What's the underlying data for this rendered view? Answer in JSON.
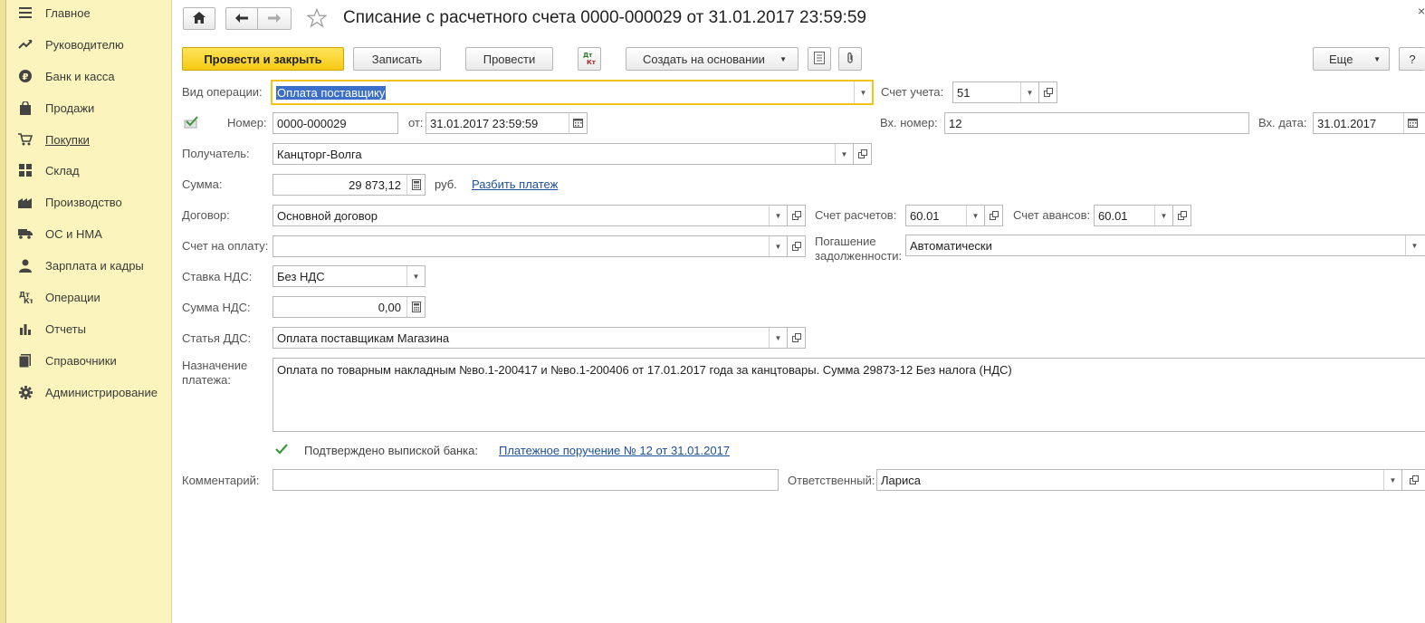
{
  "sidebar": {
    "items": [
      {
        "label": "Главное",
        "icon": "menu-icon"
      },
      {
        "label": "Руководителю",
        "icon": "trend-icon"
      },
      {
        "label": "Банк и касса",
        "icon": "ruble-icon"
      },
      {
        "label": "Продажи",
        "icon": "bag-icon"
      },
      {
        "label": "Покупки",
        "icon": "cart-icon"
      },
      {
        "label": "Склад",
        "icon": "grid-icon"
      },
      {
        "label": "Производство",
        "icon": "factory-icon"
      },
      {
        "label": "ОС и НМА",
        "icon": "truck-icon"
      },
      {
        "label": "Зарплата и кадры",
        "icon": "person-icon"
      },
      {
        "label": "Операции",
        "icon": "dtkt-icon"
      },
      {
        "label": "Отчеты",
        "icon": "bar-chart-icon"
      },
      {
        "label": "Справочники",
        "icon": "book-icon"
      },
      {
        "label": "Администрирование",
        "icon": "gear-icon"
      }
    ],
    "active_index": 4
  },
  "header": {
    "title": "Списание с расчетного счета 0000-000029 от 31.01.2017 23:59:59",
    "close": "×"
  },
  "toolbar": {
    "post_close": "Провести и закрыть",
    "save": "Записать",
    "post": "Провести",
    "create_based": "Создать на основании",
    "more": "Еще",
    "help": "?"
  },
  "form": {
    "operation_label": "Вид операции:",
    "operation_value": "Оплата поставщику",
    "account_label": "Счет учета:",
    "account_value": "51",
    "number_label": "Номер:",
    "number_value": "0000-000029",
    "from_label": "от:",
    "date_value": "31.01.2017 23:59:59",
    "in_number_label": "Вх. номер:",
    "in_number_value": "12",
    "in_date_label": "Вх. дата:",
    "in_date_value": "31.01.2017",
    "recipient_label": "Получатель:",
    "recipient_value": "Канцторг-Волга",
    "sum_label": "Сумма:",
    "sum_value": "29 873,12",
    "currency": "руб.",
    "split_link": "Разбить платеж",
    "contract_label": "Договор:",
    "contract_value": "Основной договор",
    "settle_acc_label": "Счет расчетов:",
    "settle_acc_value": "60.01",
    "advance_acc_label": "Счет авансов:",
    "advance_acc_value": "60.01",
    "invoice_label": "Счет на оплату:",
    "invoice_value": "",
    "repay_label_1": "Погашение",
    "repay_label_2": "задолженности:",
    "repay_value": "Автоматически",
    "vat_rate_label": "Ставка НДС:",
    "vat_rate_value": "Без НДС",
    "vat_sum_label": "Сумма НДС:",
    "vat_sum_value": "0,00",
    "dds_label": "Статья ДДС:",
    "dds_value": "Оплата поставщикам Магазина",
    "purpose_label_1": "Назначение",
    "purpose_label_2": "платежа:",
    "purpose_value": "Оплата по товарным накладным №во.1-200417 и №во.1-200406  от 17.01.2017 года за канцтовары. Сумма 29873-12 Без налога (НДС)",
    "confirmed_label": "Подтверждено выпиской банка:",
    "payment_link": "Платежное поручение № 12 от 31.01.2017",
    "comment_label": "Комментарий:",
    "comment_value": "",
    "responsible_label": "Ответственный:",
    "responsible_value": "Лариса"
  }
}
